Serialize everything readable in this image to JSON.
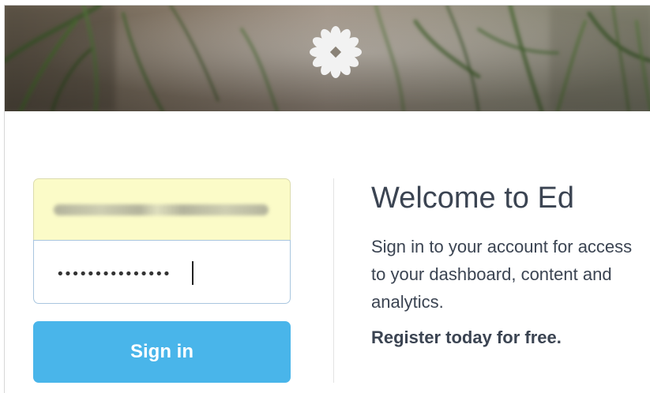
{
  "login": {
    "username_placeholder": "",
    "password_mask": "•••••••••••••••",
    "signin_label": "Sign in"
  },
  "welcome": {
    "title": "Welcome to Ed",
    "body": "Sign in to your account for access to your dashboard, content and analytics.",
    "cta": "Register today for free."
  },
  "icons": {
    "logo": "flower-logo-icon"
  },
  "colors": {
    "accent": "#49b5ea",
    "autofill": "#fbfbc8",
    "text": "#3b4452"
  }
}
